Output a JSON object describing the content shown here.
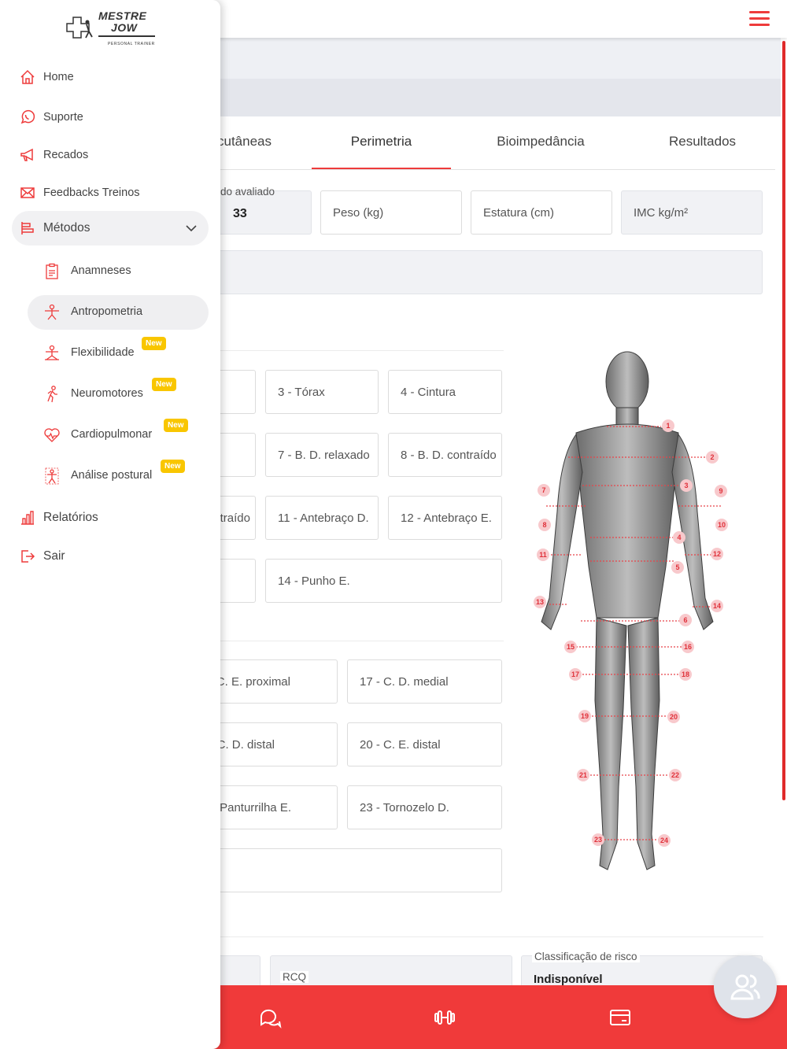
{
  "brand": {
    "line1": "MESTRE",
    "line2": "JOW",
    "tagline": "PERSONAL TRAINER"
  },
  "colors": {
    "accent": "#ee3b3b",
    "bottom_bar": "#f03a3a",
    "badge": "#f9c600"
  },
  "sidebar": {
    "items": [
      {
        "label": "Home",
        "icon": "home-icon"
      },
      {
        "label": "Suporte",
        "icon": "whatsapp-icon"
      },
      {
        "label": "Recados",
        "icon": "megaphone-icon"
      },
      {
        "label": "Feedbacks Treinos",
        "icon": "mail-icon"
      },
      {
        "label": "Métodos",
        "icon": "methods-icon"
      }
    ],
    "submenu": [
      {
        "label": "Anamneses",
        "icon": "clipboard-icon",
        "badge": ""
      },
      {
        "label": "Antropometria",
        "icon": "person-icon",
        "badge": ""
      },
      {
        "label": "Flexibilidade",
        "icon": "stretch-icon",
        "badge": "New"
      },
      {
        "label": "Neuromotores",
        "icon": "walking-icon",
        "badge": "New"
      },
      {
        "label": "Cardiopulmonar",
        "icon": "heart-pulse-icon",
        "badge": "New"
      },
      {
        "label": "Análise postural",
        "icon": "posture-icon",
        "badge": "New"
      }
    ],
    "footer": [
      {
        "label": "Relatórios",
        "icon": "chart-icon"
      },
      {
        "label": "Sair",
        "icon": "logout-icon"
      }
    ]
  },
  "tabs": [
    {
      "label": "Dobras cutâneas"
    },
    {
      "label": "Perimetria"
    },
    {
      "label": "Bioimpedância"
    },
    {
      "label": "Resultados"
    }
  ],
  "top_fields": {
    "age_label": "Idade do avaliado",
    "age_value": "33",
    "weight": "Peso (kg)",
    "height": "Estatura (cm)",
    "bmi": "IMC kg/m²"
  },
  "trunk_fields": [
    "3 - Tórax",
    "4 - Cintura",
    "7 - B. D. relaxado",
    "8 - B. D. contraído",
    "10 - B. E. contraído",
    "11 - Antebraço D.",
    "12 - Antebraço E.",
    "14 - Punho E."
  ],
  "leg_fields": [
    "16 - C. E. proximal",
    "17 - C. D. medial",
    "19 - C. D. distal",
    "20 - C. E. distal",
    "22 - Panturrilha E.",
    "23 - Tornozelo D."
  ],
  "results": {
    "rcq": "RCQ",
    "risk_label": "Classificação de risco",
    "risk_value": "Indisponível"
  },
  "body_markers": [
    "1",
    "2",
    "3",
    "4",
    "5",
    "6",
    "7",
    "8",
    "9",
    "10",
    "11",
    "12",
    "13",
    "14",
    "15",
    "16",
    "17",
    "18",
    "19",
    "20",
    "21",
    "22",
    "23",
    "24"
  ]
}
